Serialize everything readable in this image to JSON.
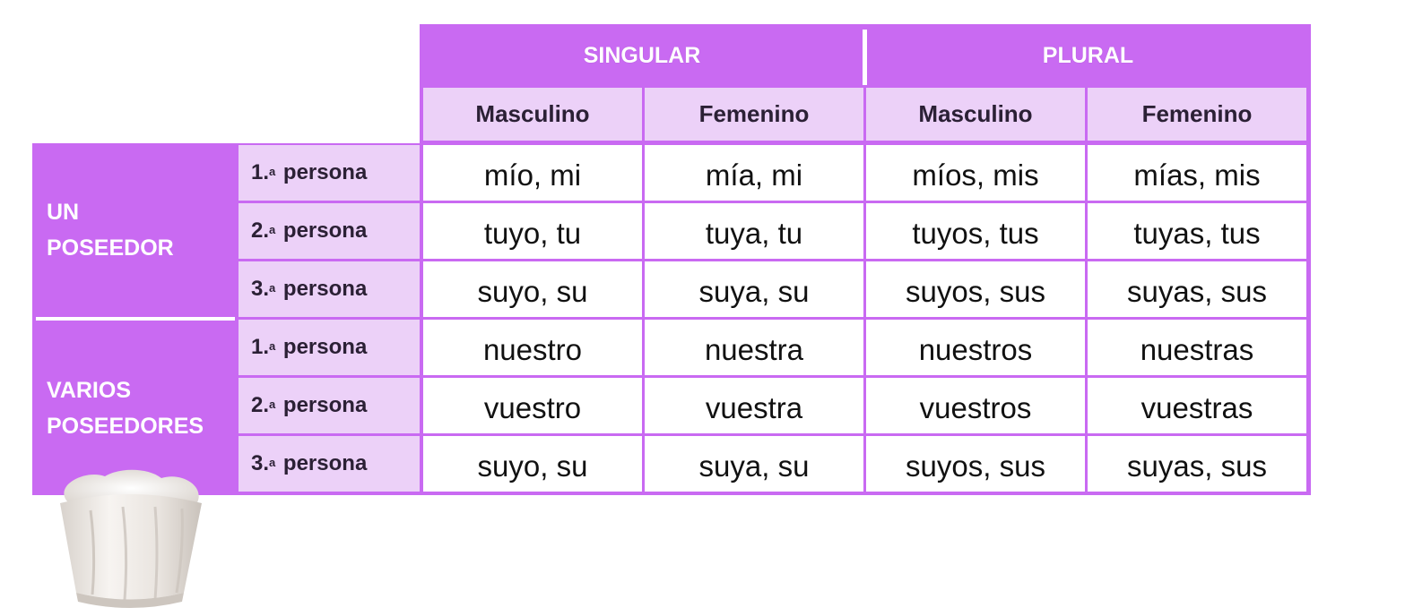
{
  "header": {
    "singular": "SINGULAR",
    "plural": "PLURAL",
    "sub": [
      "Masculino",
      "Femenino",
      "Masculino",
      "Femenino"
    ]
  },
  "groups": [
    {
      "line1": "UN",
      "line2": "POSEEDOR"
    },
    {
      "line1": "VARIOS",
      "line2": "POSEEDORES"
    }
  ],
  "rows": [
    {
      "num": "1.",
      "ord": "a",
      "person": "persona",
      "cells": [
        "mío, mi",
        "mía, mi",
        "míos, mis",
        "mías, mis"
      ]
    },
    {
      "num": "2.",
      "ord": "a",
      "person": "persona",
      "cells": [
        "tuyo, tu",
        "tuya, tu",
        "tuyos, tus",
        "tuyas, tus"
      ]
    },
    {
      "num": "3.",
      "ord": "a",
      "person": "persona",
      "cells": [
        "suyo, su",
        "suya, su",
        "suyos, sus",
        "suyas, sus"
      ]
    },
    {
      "num": "1.",
      "ord": "a",
      "person": "persona",
      "cells": [
        "nuestro",
        "nuestra",
        "nuestros",
        "nuestras"
      ]
    },
    {
      "num": "2.",
      "ord": "a",
      "person": "persona",
      "cells": [
        "vuestro",
        "vuestra",
        "vuestros",
        "vuestras"
      ]
    },
    {
      "num": "3.",
      "ord": "a",
      "person": "persona",
      "cells": [
        "suyo, su",
        "suya, su",
        "suyos, sus",
        "suyas, sus"
      ]
    }
  ],
  "colors": {
    "purple": "#c96af2",
    "lilac": "#ecd1f8",
    "text": "#111111"
  },
  "decoration": {
    "icon": "chef-hat-icon"
  }
}
